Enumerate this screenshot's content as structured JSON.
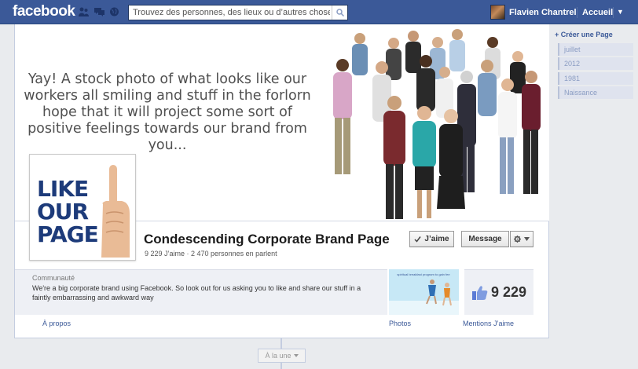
{
  "topbar": {
    "logo": "facebook",
    "search_placeholder": "Trouvez des personnes, des lieux ou d’autres choses",
    "user_name": "Flavien Chantrel",
    "home_label": "Accueil"
  },
  "cover": {
    "text": "Yay! A stock photo of what looks like our workers all smiling and stuff in the forlorn hope that it will project some sort of positive feelings towards our brand from you..."
  },
  "profile_picture": {
    "text_line1": "LIKE",
    "text_line2": "OUR",
    "text_line3": "PAGE"
  },
  "page": {
    "name": "Condescending Corporate Brand Page",
    "stats": "9 229 J’aime · 2 470 personnes en parlent",
    "like_button": "J’aime",
    "message_button": "Message"
  },
  "about": {
    "category": "Communauté",
    "description": "We're a big corporate brand using Facebook. So look out for us asking you to like and share our stuff in a faintly embarrassing and awkward way",
    "tab_label": "À propos"
  },
  "photos": {
    "thumb_caption": "spiritual breakfast program to gain fee",
    "tab_label": "Photos"
  },
  "likes": {
    "count": "9 229",
    "tab_label": "Mentions J’aime"
  },
  "sidebar": {
    "create_page": "Créer une Page",
    "years": [
      "juillet",
      "2012",
      "1981",
      "Naissance"
    ]
  },
  "timeline": {
    "a_la_une": "À la une"
  },
  "colors": {
    "brand_blue": "#3b5998",
    "link_blue": "#3b5998",
    "background": "#e9ebee"
  },
  "icons": [
    "friend-requests-icon",
    "messages-icon",
    "notifications-globe-icon",
    "search-icon",
    "gear-icon",
    "thumbs-up-icon",
    "chevron-down-icon",
    "plus-icon"
  ]
}
